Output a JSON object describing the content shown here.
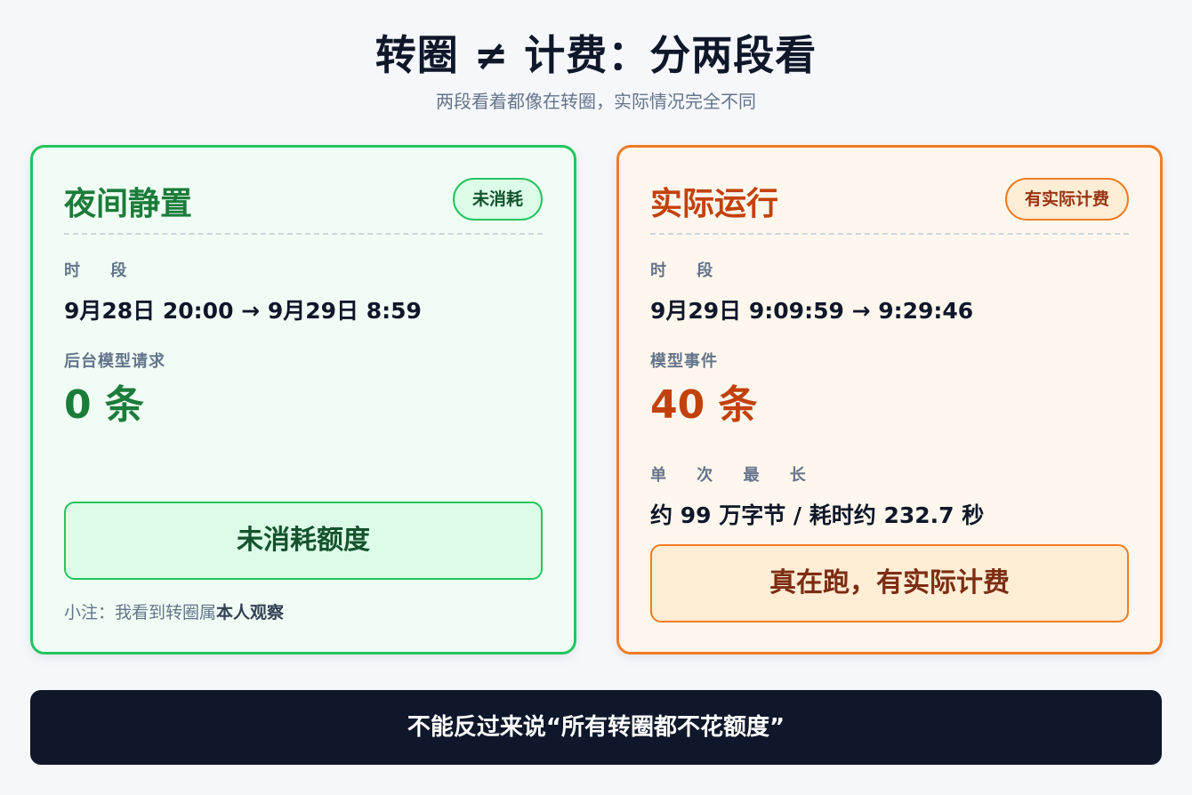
{
  "header": {
    "title": "转圈 ≠ 计费：分两段看",
    "subtitle": "两段看着都像在转圈，实际情况完全不同"
  },
  "left_card": {
    "title": "夜间静置",
    "badge": "未消耗",
    "period_label": "时 段",
    "period_value": "9月28日 20:00 → 9月29日 8:59",
    "requests_label": "后台模型请求",
    "requests_value": "0 条",
    "verdict": "未消耗额度",
    "note_prefix": "小注：我看到转圈属",
    "note_bold": "本人观察"
  },
  "right_card": {
    "title": "实际运行",
    "badge": "有实际计费",
    "period_label": "时 段",
    "period_value": "9月29日 9:09:59 → 9:29:46",
    "events_label": "模型事件",
    "events_value": "40 条",
    "max_label": "单 次 最 长",
    "max_value": "约 99 万字节 / 耗时约 232.7 秒",
    "verdict": "真在跑，有实际计费"
  },
  "banner": {
    "text": "不能反过来说“所有转圈都不花额度”"
  },
  "colors": {
    "green_accent": "#22c55e",
    "orange_accent": "#f07c23",
    "dark_banner": "#0f172a"
  }
}
